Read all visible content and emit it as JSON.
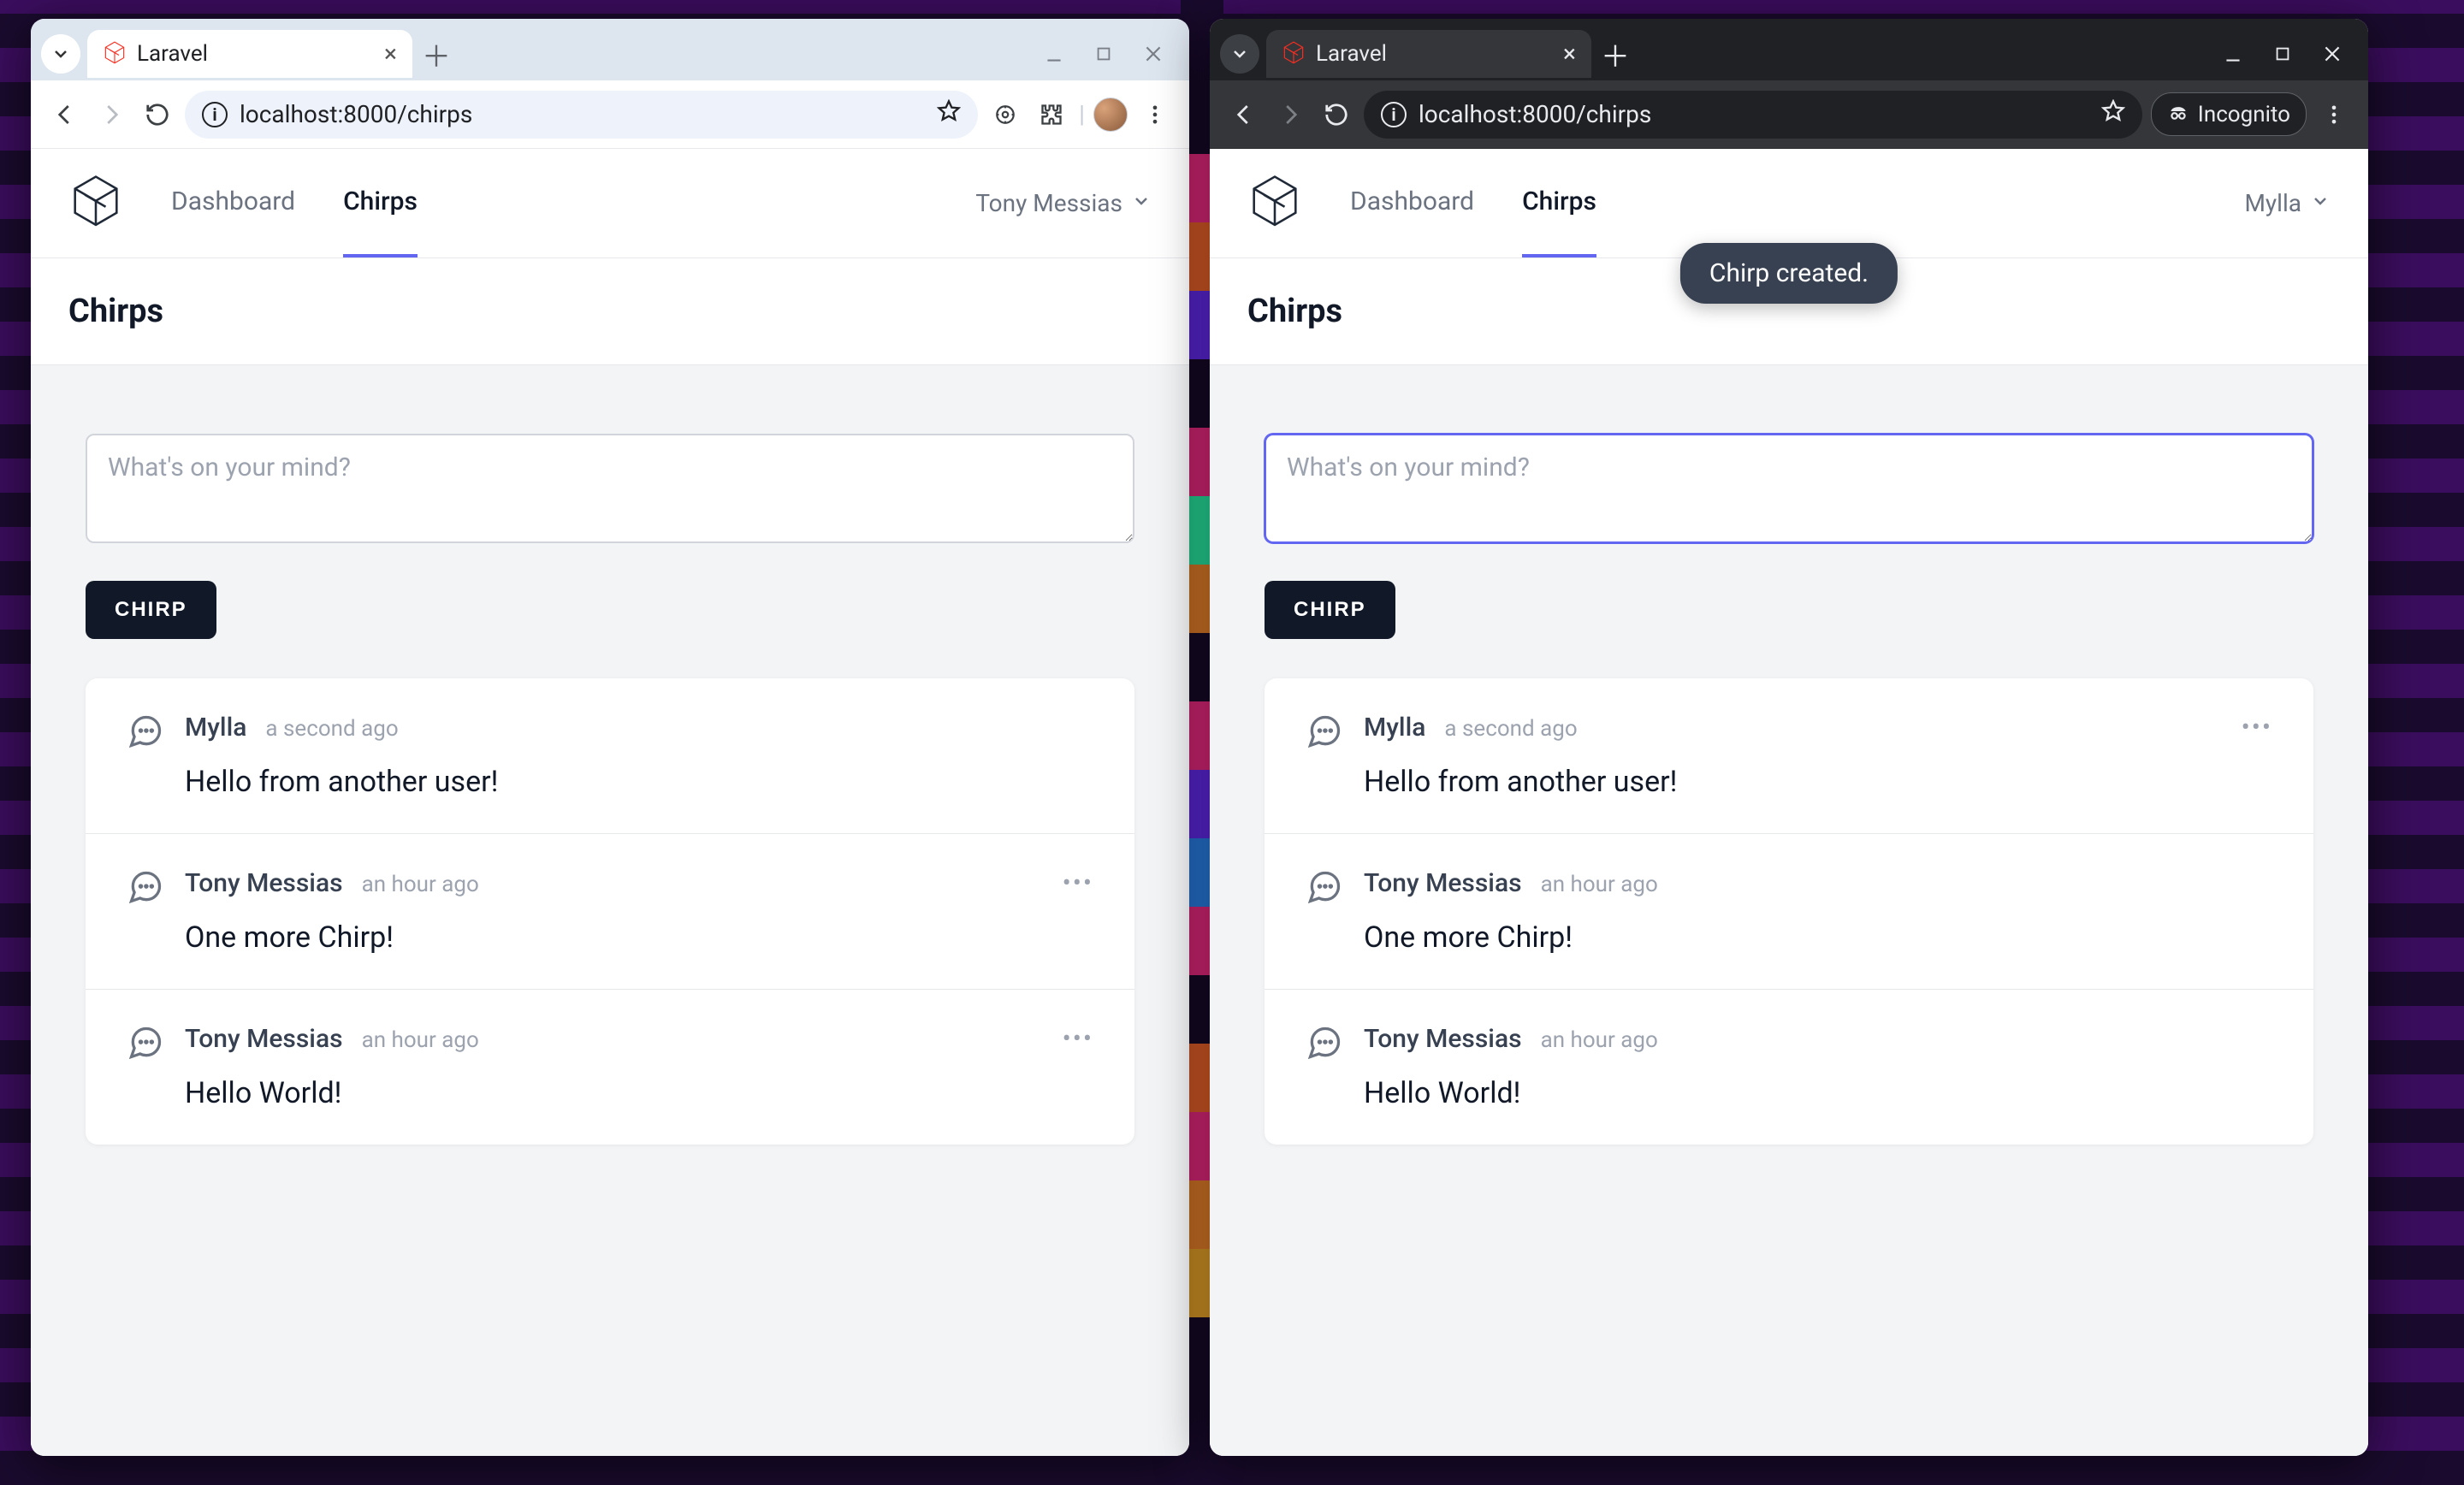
{
  "windows": [
    {
      "id": "left",
      "theme": "light",
      "tab_title": "Laravel",
      "url": "localhost:8000/chirps",
      "mode": "normal",
      "user_label": "Tony Messias",
      "nav": {
        "dashboard": "Dashboard",
        "chirps": "Chirps"
      },
      "active_nav": "chirps",
      "page_title": "Chirps",
      "textarea_placeholder": "What's on your mind?",
      "textarea_focused": false,
      "submit_label": "Chirp",
      "toast": null,
      "chirps": [
        {
          "author": "Mylla",
          "time": "a second ago",
          "message": "Hello from another user!",
          "own": false
        },
        {
          "author": "Tony Messias",
          "time": "an hour ago",
          "message": "One more Chirp!",
          "own": true
        },
        {
          "author": "Tony Messias",
          "time": "an hour ago",
          "message": "Hello World!",
          "own": true
        }
      ]
    },
    {
      "id": "right",
      "theme": "dark",
      "tab_title": "Laravel",
      "url": "localhost:8000/chirps",
      "mode": "incognito",
      "incognito_label": "Incognito",
      "user_label": "Mylla",
      "nav": {
        "dashboard": "Dashboard",
        "chirps": "Chirps"
      },
      "active_nav": "chirps",
      "page_title": "Chirps",
      "textarea_placeholder": "What's on your mind?",
      "textarea_focused": true,
      "submit_label": "Chirp",
      "toast": "Chirp created.",
      "chirps": [
        {
          "author": "Mylla",
          "time": "a second ago",
          "message": "Hello from another user!",
          "own": true
        },
        {
          "author": "Tony Messias",
          "time": "an hour ago",
          "message": "One more Chirp!",
          "own": false
        },
        {
          "author": "Tony Messias",
          "time": "an hour ago",
          "message": "Hello World!",
          "own": false
        }
      ]
    }
  ]
}
